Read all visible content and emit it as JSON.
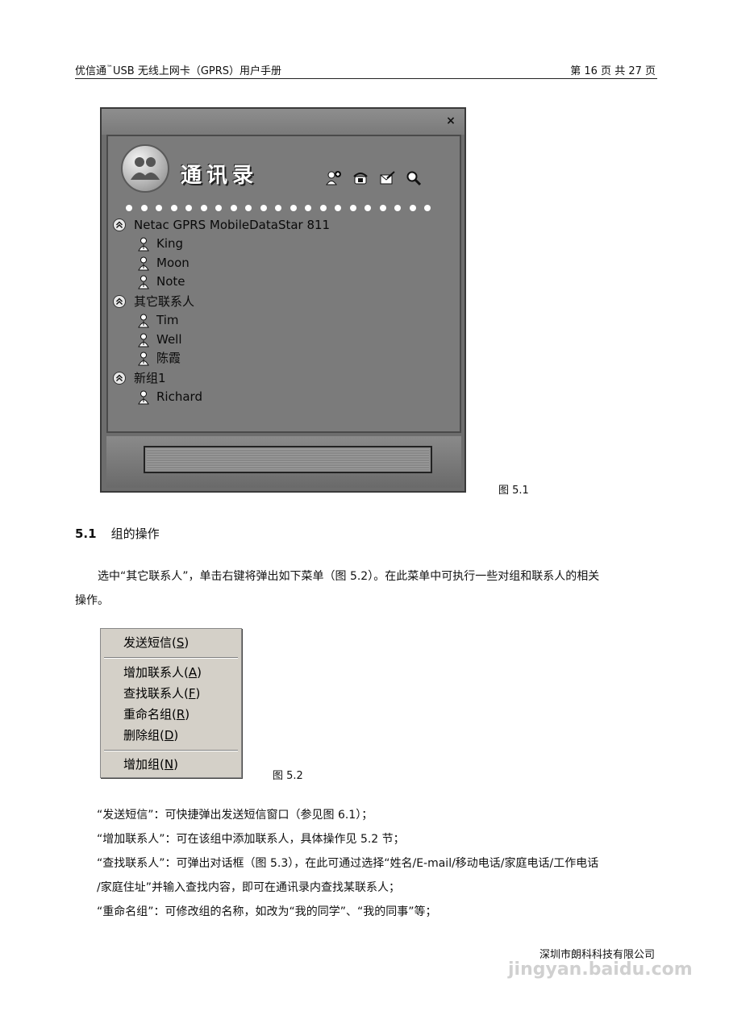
{
  "header": {
    "left_prefix": "优信通",
    "tm": "™",
    "left_suffix": "USB 无线上网卡（GPRS）用户手册",
    "right": "第 16 页 共 27 页"
  },
  "address_book": {
    "close_glyph": "×",
    "title": "通讯录",
    "groups": [
      {
        "name": "Netac GPRS MobileDataStar 811",
        "contacts": [
          "King",
          "Moon",
          "Note"
        ]
      },
      {
        "name": "其它联系人",
        "contacts": [
          "Tim",
          "Well",
          "陈霞"
        ]
      },
      {
        "name": "新组1",
        "contacts": [
          "Richard"
        ]
      }
    ]
  },
  "fig1_caption": "图 5.1",
  "section": {
    "number": "5.1",
    "title": "组的操作"
  },
  "paragraph1_line1": "选中“其它联系人”，单击右键将弹出如下菜单（图 5.2）。在此菜单中可执行一些对组和联系人的相关",
  "paragraph1_line2": "操作。",
  "context_menu": {
    "items": [
      {
        "label": "发送短信(",
        "key": "S",
        "end": ")"
      },
      {
        "label": "增加联系人(",
        "key": "A",
        "end": ")"
      },
      {
        "label": "查找联系人(",
        "key": "F",
        "end": ")"
      },
      {
        "label": "重命名组(",
        "key": "R",
        "end": ")"
      },
      {
        "label": "删除组(",
        "key": "D",
        "end": ")"
      },
      {
        "label": "增加组(",
        "key": "N",
        "end": ")"
      }
    ]
  },
  "fig2_caption": "图 5.2",
  "descriptions": {
    "line1": "“发送短信”：可快捷弹出发送短信窗口（参见图 6.1）；",
    "line2": "“增加联系人”：可在该组中添加联系人，具体操作见 5.2 节；",
    "line3": "“查找联系人”：可弹出对话框（图 5.3），在此可通过选择“姓名/E-mail/移动电话/家庭电话/工作电话",
    "line4": "/家庭住址”并输入查找内容，即可在通讯录内查找某联系人；",
    "line5": "“重命名组”：可修改组的名称，如改为“我的同学”、“我的同事”等；"
  },
  "footer": "深圳市朗科科技有限公司",
  "watermark": "jingyan.baidu.com"
}
